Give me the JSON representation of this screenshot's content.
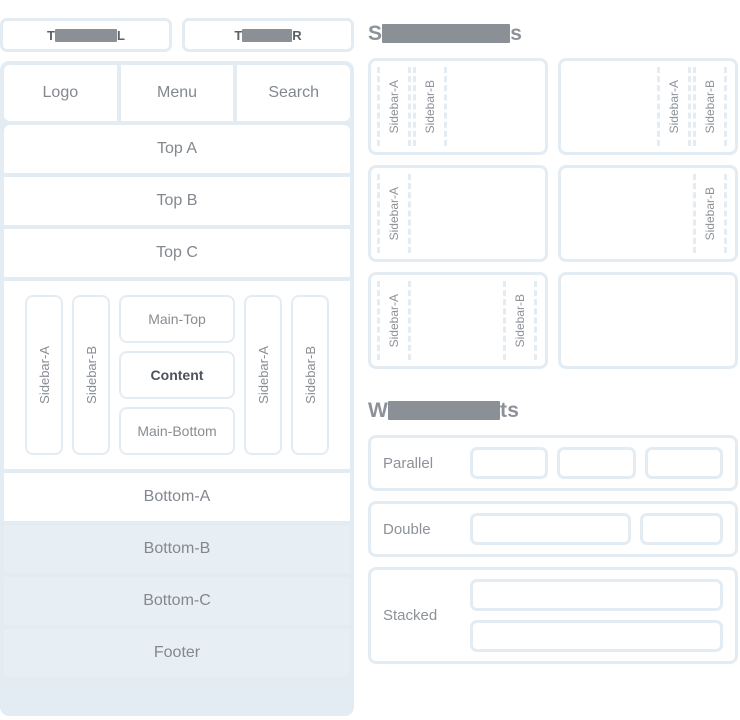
{
  "tabs": [
    {
      "prefix": "T",
      "redacted_width": 62,
      "suffix": "L"
    },
    {
      "prefix": "T",
      "redacted_width": 50,
      "suffix": "R"
    }
  ],
  "shell": {
    "header": [
      {
        "label": "Logo"
      },
      {
        "label": "Menu"
      },
      {
        "label": "Search"
      }
    ],
    "top_bands": [
      {
        "label": "Top A",
        "tinted": false
      },
      {
        "label": "Top B",
        "tinted": false
      },
      {
        "label": "Top C",
        "tinted": false
      }
    ],
    "body": {
      "left_rails": [
        {
          "label": "Sidebar-A"
        },
        {
          "label": "Sidebar-B"
        }
      ],
      "main": [
        {
          "label": "Main-Top",
          "strong": false
        },
        {
          "label": "Content",
          "strong": true
        },
        {
          "label": "Main-Bottom",
          "strong": false
        }
      ],
      "right_rails": [
        {
          "label": "Sidebar-A"
        },
        {
          "label": "Sidebar-B"
        }
      ]
    },
    "bottom_bands": [
      {
        "label": "Bottom-A",
        "tinted": false
      },
      {
        "label": "Bottom-B",
        "tinted": true
      },
      {
        "label": "Bottom-C",
        "tinted": true
      },
      {
        "label": "Footer",
        "tinted": true
      }
    ]
  },
  "sections": {
    "sidebar_layouts": {
      "title_prefix": "S",
      "title_redacted_width": 128,
      "title_suffix": "s",
      "cells": [
        {
          "left": [
            "Sidebar-A",
            "Sidebar-B"
          ],
          "right": []
        },
        {
          "left": [],
          "right": [
            "Sidebar-A",
            "Sidebar-B"
          ]
        },
        {
          "left": [
            "Sidebar-A"
          ],
          "right": []
        },
        {
          "left": [],
          "right": [
            "Sidebar-B"
          ]
        },
        {
          "left": [
            "Sidebar-A"
          ],
          "right": [
            "Sidebar-B"
          ]
        },
        {
          "left": [],
          "right": []
        }
      ]
    },
    "widget_layouts": {
      "title_prefix": "W",
      "title_redacted_width": 112,
      "title_suffix": "ts",
      "rows": [
        {
          "label": "Parallel",
          "mode": "row",
          "boxes": [
            "eq",
            "eq",
            "eq"
          ]
        },
        {
          "label": "Double",
          "mode": "row",
          "boxes": [
            "wide",
            "narrow"
          ]
        },
        {
          "label": "Stacked",
          "mode": "col",
          "boxes": [
            "full",
            "full"
          ]
        }
      ]
    }
  },
  "colors": {
    "panel": "#e4ecf3",
    "card": "#ffffff",
    "text": "#8d9298",
    "redaction": "#8b9096",
    "tint": "#e7eef4"
  }
}
